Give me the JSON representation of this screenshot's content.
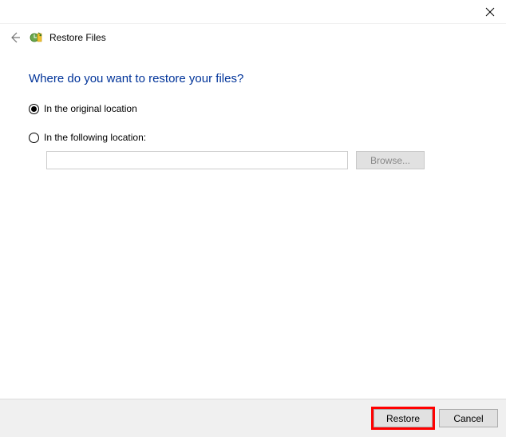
{
  "window": {
    "title": "Restore Files"
  },
  "main": {
    "heading": "Where do you want to restore your files?",
    "options": {
      "original": {
        "label": "In the original location",
        "selected": true
      },
      "following": {
        "label": "In the following location:",
        "selected": false,
        "path": ""
      }
    },
    "browse_label": "Browse..."
  },
  "footer": {
    "restore_label": "Restore",
    "cancel_label": "Cancel"
  }
}
